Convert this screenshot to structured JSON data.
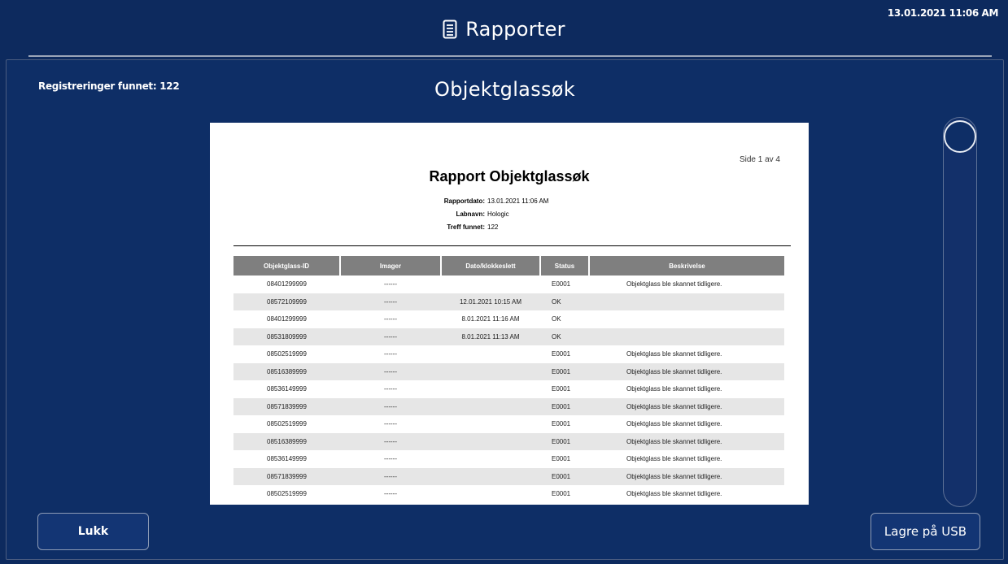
{
  "header": {
    "title": "Rapporter",
    "icon": "document-icon",
    "timestamp": "13.01.2021 11:06 AM"
  },
  "panel": {
    "records_found_label": "Registreringer funnet:",
    "records_found_count": "122",
    "title": "Objektglassøk"
  },
  "report": {
    "page_label": "Side 1 av 4",
    "title": "Rapport Objektglassøk",
    "meta": [
      {
        "label": "Rapportdato:",
        "value": "13.01.2021 11:06 AM"
      },
      {
        "label": "Labnavn:",
        "value": "Hologic"
      },
      {
        "label": "Treff funnet:",
        "value": "122"
      }
    ],
    "columns": [
      "Objektglass-ID",
      "Imager",
      "Dato/klokkeslett",
      "Status",
      "Beskrivelse"
    ],
    "rows": [
      [
        "08401299999",
        "------",
        "",
        "E0001",
        "Objektglass ble skannet tidligere."
      ],
      [
        "08572109999",
        "------",
        "12.01.2021 10:15 AM",
        "OK",
        ""
      ],
      [
        "08401299999",
        "------",
        "8.01.2021 11:16 AM",
        "OK",
        ""
      ],
      [
        "08531809999",
        "------",
        "8.01.2021 11:13 AM",
        "OK",
        ""
      ],
      [
        "08502519999",
        "------",
        "",
        "E0001",
        "Objektglass ble skannet tidligere."
      ],
      [
        "08516389999",
        "------",
        "",
        "E0001",
        "Objektglass ble skannet tidligere."
      ],
      [
        "08536149999",
        "------",
        "",
        "E0001",
        "Objektglass ble skannet tidligere."
      ],
      [
        "08571839999",
        "------",
        "",
        "E0001",
        "Objektglass ble skannet tidligere."
      ],
      [
        "08502519999",
        "------",
        "",
        "E0001",
        "Objektglass ble skannet tidligere."
      ],
      [
        "08516389999",
        "------",
        "",
        "E0001",
        "Objektglass ble skannet tidligere."
      ],
      [
        "08536149999",
        "------",
        "",
        "E0001",
        "Objektglass ble skannet tidligere."
      ],
      [
        "08571839999",
        "------",
        "",
        "E0001",
        "Objektglass ble skannet tidligere."
      ],
      [
        "08502519999",
        "------",
        "",
        "E0001",
        "Objektglass ble skannet tidligere."
      ]
    ]
  },
  "buttons": {
    "close_label": "Lukk",
    "usb_label": "Lagre på USB"
  },
  "colors": {
    "background": "#0d2a5e",
    "panel": "#0e2e66",
    "table_header": "#7f7f7f",
    "row_alt": "#e6e6e6"
  }
}
